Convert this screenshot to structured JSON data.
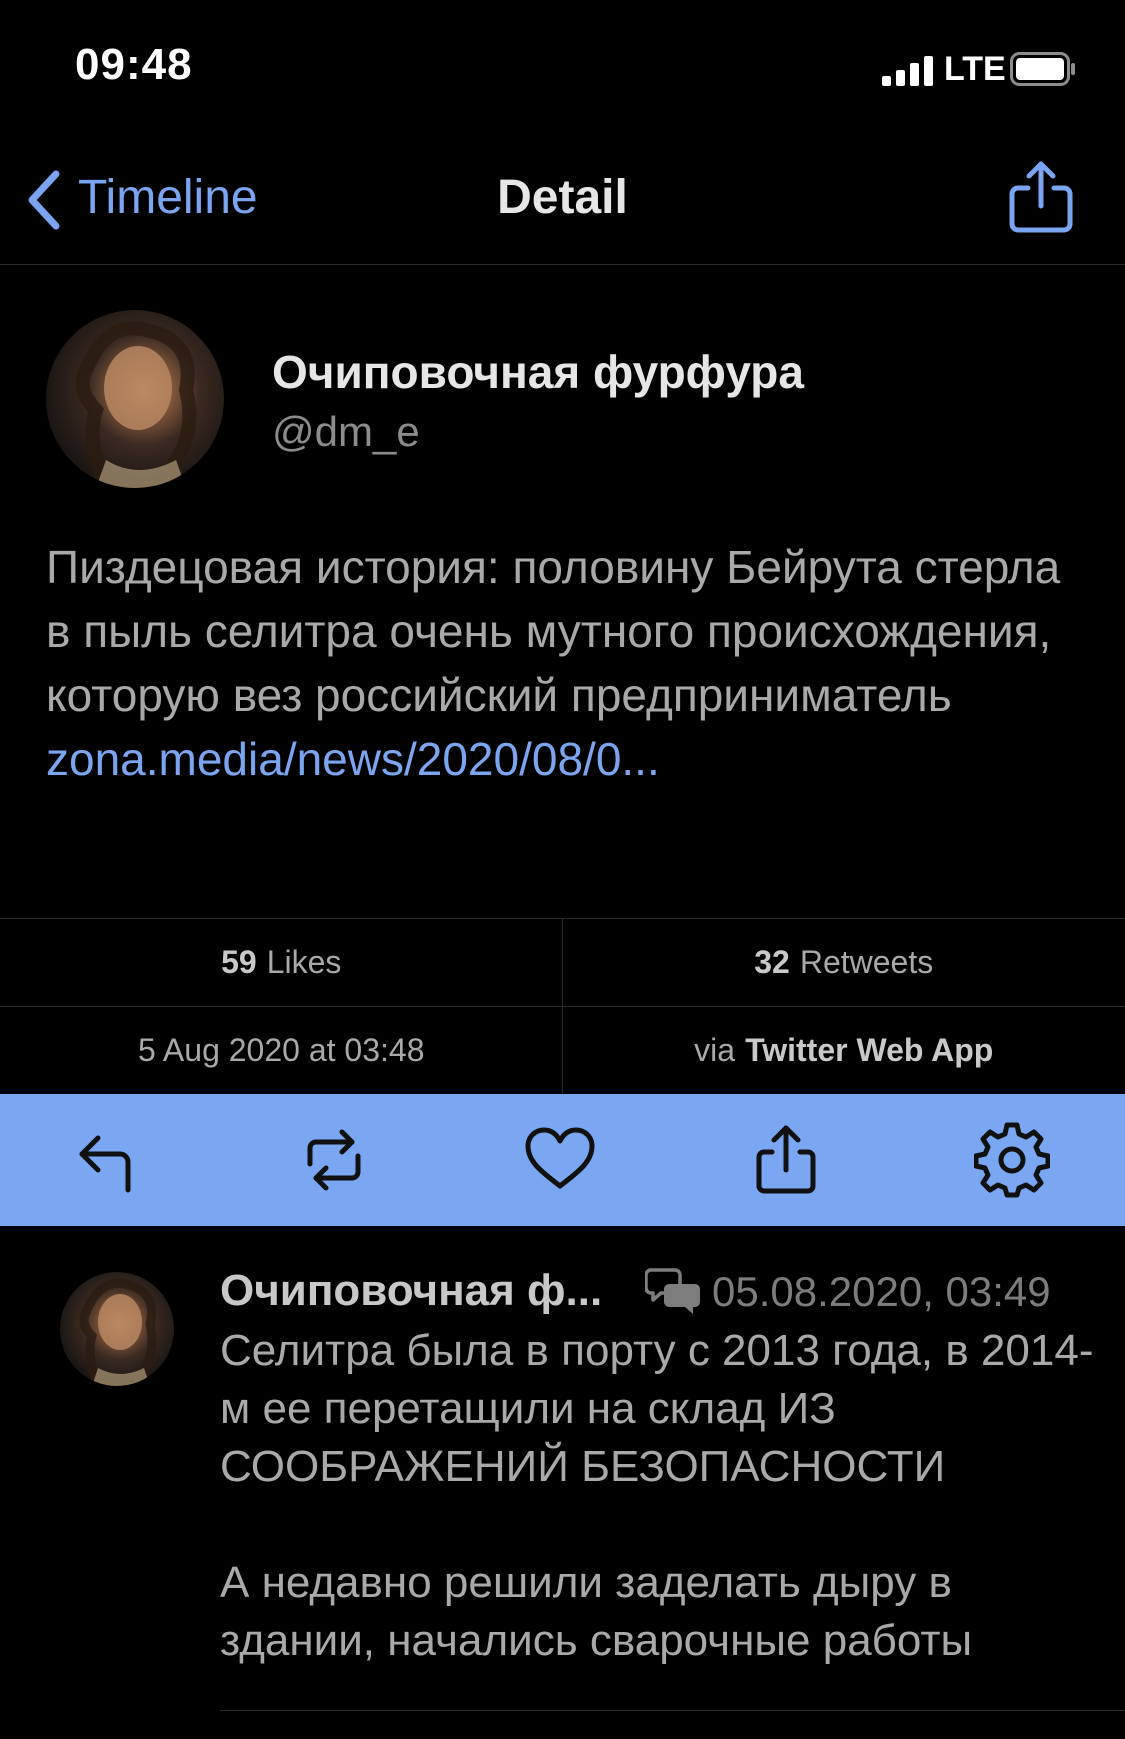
{
  "status_bar": {
    "time": "09:48",
    "network": "LTE"
  },
  "nav": {
    "back_label": "Timeline",
    "title": "Detail"
  },
  "tweet": {
    "author_name": "Очиповочная фурфура",
    "handle": "@dm_e",
    "text": "Пиздецовая история: половину Бейрута стерла в пыль селитра очень мутного происхождения, которую вез российский предприниматель",
    "link": "zona.media/news/2020/08/0..."
  },
  "stats": {
    "likes_count": "59",
    "likes_label": "Likes",
    "retweets_count": "32",
    "retweets_label": "Retweets",
    "date": "5 Aug 2020 at 03:48",
    "via_prefix": "via",
    "via_app": "Twitter Web App"
  },
  "actions": [
    "reply-icon",
    "retweet-icon",
    "heart-icon",
    "share-icon",
    "gear-icon"
  ],
  "reply": {
    "author_name": "Очиповочная ф...",
    "timestamp": "05.08.2020, 03:49",
    "paragraph1": "Селитра была в порту с 2013 года, в 2014-м ее перетащили на склад ИЗ СООБРАЖЕНИЙ БЕЗОПАСНОСТИ",
    "paragraph2": "А недавно решили заделать дыру в здании, начались сварочные работы"
  },
  "colors": {
    "accent": "#7ba5f0",
    "action_bar": "#7aa6f2",
    "background": "#000000"
  }
}
